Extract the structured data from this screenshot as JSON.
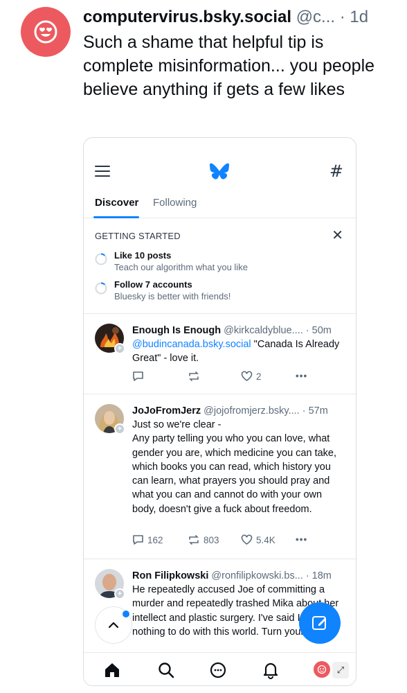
{
  "post": {
    "author_display": "computervirus.bsky.social",
    "handle_trunc": "@c...",
    "separator": "·",
    "time": "1d",
    "text": "Such a shame that helpful tip is complete misinformation... you people believe anything if gets a few likes"
  },
  "screenshot": {
    "tabs": [
      {
        "label": "Discover",
        "active": true
      },
      {
        "label": "Following",
        "active": false
      }
    ],
    "getting_started": {
      "title": "GETTING STARTED",
      "items": [
        {
          "label": "Like 10 posts",
          "sub": "Teach our algorithm what you like"
        },
        {
          "label": "Follow 7 accounts",
          "sub": "Bluesky is better with friends!"
        }
      ]
    },
    "feed": [
      {
        "name": "Enough Is Enough",
        "handle": "@kirkcaldyblue....",
        "time": "· 50m",
        "mention": "@budincanada.bsky.social",
        "text": " \"Canada Is Already Great\" - love it.",
        "replies": "",
        "reposts": "",
        "likes": "2"
      },
      {
        "name": "JoJoFromJerz",
        "handle": "@jojofromjerz.bsky....",
        "time": "· 57m",
        "line1": "Just so we're clear -",
        "text": "Any party telling you who you can love, what gender you are, which medicine you can take, which books you can read, which history you can learn, what prayers you should pray and what you can and cannot do with your own body, doesn't give a fuck about freedom.",
        "replies": "162",
        "reposts": "803",
        "likes": "5.4K"
      },
      {
        "name": "Ron Filipkowski",
        "handle": "@ronfilipkowski.bs...",
        "time": "· 18m",
        "text": "He repeatedly accused Joe of committing a murder and repeatedly trashed Mika about her intellect and plastic surgery. I've said I have nothing to do with this world. Turn your TV off."
      }
    ],
    "colors": {
      "accent": "#1083fe",
      "avatar_main": "#ec5a5f",
      "muted": "#5d6b7a"
    }
  }
}
